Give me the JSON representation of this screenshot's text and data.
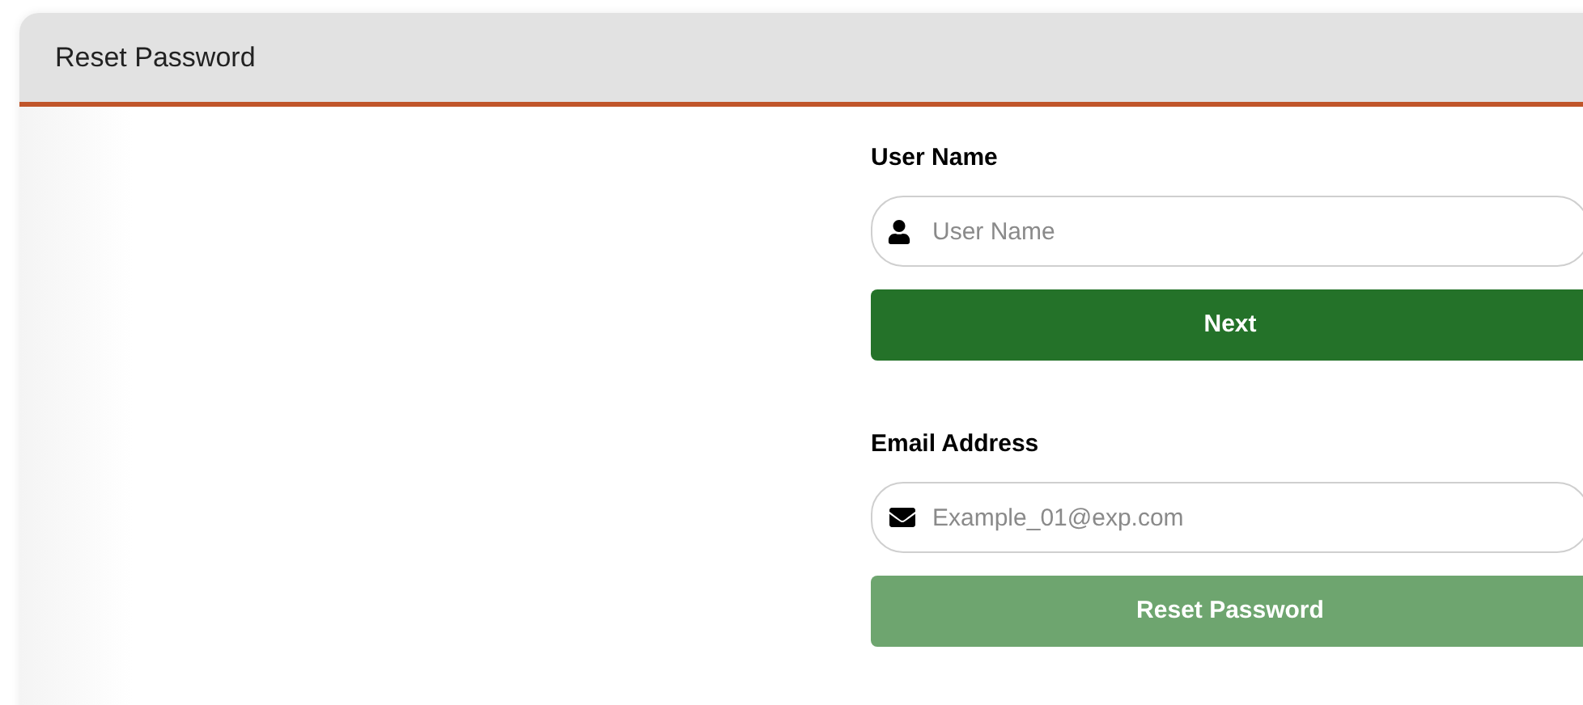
{
  "panel": {
    "title": "Reset Password"
  },
  "sections": [
    {
      "label": "User Name",
      "field": {
        "kind": "user",
        "placeholder": "User Name"
      },
      "button": {
        "label": "Next",
        "disabled": false
      }
    },
    {
      "label": "Email Address",
      "field": {
        "kind": "email",
        "placeholder": "Example_01@exp.com"
      },
      "button": {
        "label": "Reset Password",
        "disabled": true
      }
    }
  ]
}
